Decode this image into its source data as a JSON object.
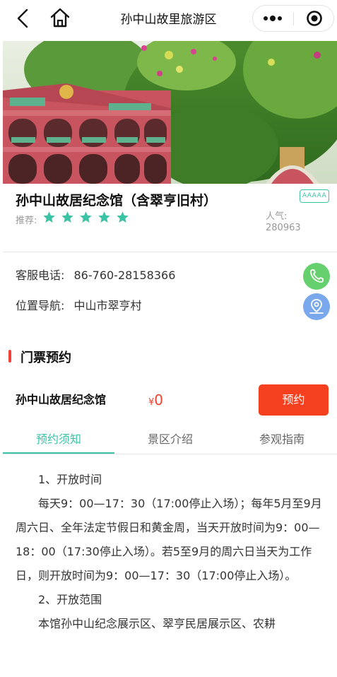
{
  "nav": {
    "title": "孙中山故里旅游区"
  },
  "spot": {
    "name": "孙中山故居纪念馆（含翠亨旧村）",
    "level_badge": "AAAAA",
    "recommend_label": "推荐:",
    "stars": 5,
    "star_color": "#3cc3a6",
    "popularity_label": "人气:",
    "popularity_value": "280963"
  },
  "contact": {
    "phone_label": "客服电话:",
    "phone": "86-760-28158366",
    "address_label": "位置导航:",
    "address": "中山市翠亨村",
    "call_icon": "phone-icon",
    "nav_icon": "location-pin-icon"
  },
  "tickets": {
    "section_title": "门票预约",
    "items": [
      {
        "name": "孙中山故居纪念馆",
        "currency": "¥",
        "price": "0",
        "button": "预约"
      }
    ]
  },
  "tabs": [
    {
      "label": "预约须知",
      "active": true
    },
    {
      "label": "景区介绍",
      "active": false
    },
    {
      "label": "参观指南",
      "active": false
    }
  ],
  "notice": {
    "paragraphs": [
      "1、开放时间",
      "每天9：00—17：30（17:00停止入场）；每年5月至9月周六日、全年法定节假日和黄金周，当天开放时间为9：00—18：00（17:30停止入场）。若5至9月的周六日当天为工作日，则开放时间为9：00—17：30（17:00停止入场）。",
      "2、开放范围",
      "本馆孙中山纪念展示区、翠亨民居展示区、农耕"
    ]
  },
  "colors": {
    "accent": "#3cc3a6",
    "primary_button": "#f5401f",
    "price": "#f5402e",
    "section_bar": "#f0423a"
  }
}
